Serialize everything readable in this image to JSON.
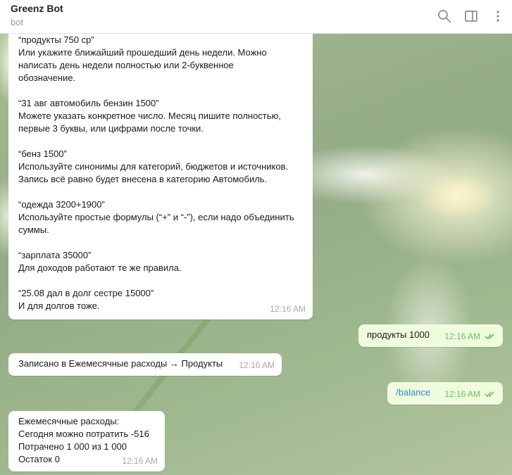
{
  "header": {
    "title": "Greenz Bot",
    "subtitle": "bot",
    "icons": [
      "search-icon",
      "sidebar-toggle-icon",
      "more-vertical-icon"
    ]
  },
  "messages": [
    {
      "direction": "in",
      "lines": [
        "“продукты 750 ср”",
        "Или укажите ближайший прошедший день недели. Можно",
        "написать день недели полностью или 2-буквенное",
        "обозначение.",
        "",
        "“31 авг автомобиль бензин 1500”",
        "Можете указать конкретное число. Месяц пишите полностью,",
        "первые 3 буквы, или цифрами после точки.",
        "",
        "“бенз 1500”",
        "Используйте синонимы для категорий, бюджетов и источников.",
        "Запись всё равно будет внесена в категорию Автомобиль.",
        "",
        "“одежда 3200+1900”",
        "Используйте простые формулы (“+” и “-”), если надо объединить",
        "суммы.",
        "",
        "“зарплата 35000”",
        "Для доходов работают те же правила.",
        "",
        "“25.08 дал в долг сестре 15000”",
        "И для долгов тоже."
      ],
      "time": "12:16 AM"
    },
    {
      "direction": "out",
      "text": "продукты 1000",
      "time": "12:16 AM"
    },
    {
      "direction": "in",
      "text": "Записано в Ежемесячные расходы → Продукты",
      "time": "12:16 AM"
    },
    {
      "direction": "out",
      "text": "/balance",
      "time": "12:16 AM"
    },
    {
      "direction": "in",
      "lines": [
        "Ежемесячные расходы:",
        "Сегодня можно потратить -516",
        "Потрачено 1 000 из 1 000",
        "Остаток 0"
      ],
      "time": "12:16 AM"
    }
  ],
  "colors": {
    "incoming_bubble": "#ffffff",
    "outgoing_bubble": "#effdde",
    "read_check": "#6cbf61",
    "command_link": "#2a8bd0"
  }
}
